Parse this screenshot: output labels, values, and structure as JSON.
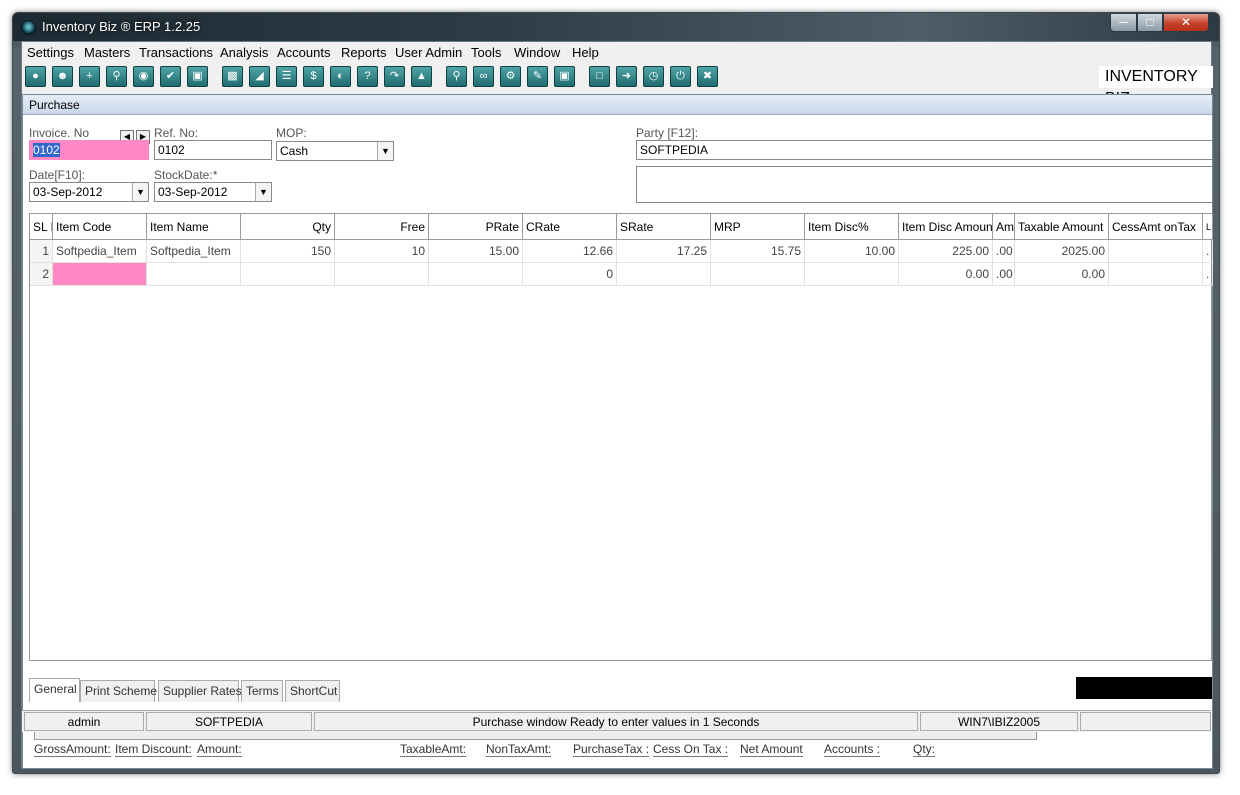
{
  "window": {
    "title": "Inventory Biz ®  ERP 1.2.25",
    "brand": "INVENTORY BIZ"
  },
  "menu": [
    "Settings",
    "Masters",
    "Transactions",
    "Analysis",
    "Accounts",
    "Reports",
    "User Admin",
    "Tools",
    "Window",
    "Help"
  ],
  "toolbar_icons": [
    "new-icon",
    "user-icon",
    "add-icon",
    "search-icon",
    "disk-icon",
    "check-icon",
    "stack-icon",
    "cart-icon",
    "car-icon",
    "list-icon",
    "dollar-icon",
    "globe-icon",
    "help-icon",
    "redo-icon",
    "up-icon",
    "zoom-icon",
    "binoculars-icon",
    "gear-icon",
    "pen-icon",
    "layers-icon",
    "folder-icon",
    "export-icon",
    "clock-icon",
    "power-icon",
    "close-icon"
  ],
  "form": {
    "title": "Purchase",
    "invoice_label": "Invoice. No",
    "invoice_value": "0102",
    "ref_label": "Ref. No:",
    "ref_value": "0102",
    "mop_label": "MOP:",
    "mop_value": "Cash",
    "party_label": "Party [F12]:",
    "party_value": "SOFTPEDIA",
    "date_label": "Date[F10]:",
    "date_value": "03-Sep-2012",
    "stockdate_label": "StockDate:*",
    "stockdate_value": "03-Sep-2012"
  },
  "grid": {
    "headers": [
      "SL N",
      "Item Code",
      "Item Name",
      "Qty",
      "Free",
      "PRate",
      "CRate",
      "SRate",
      "MRP",
      "Item Disc%",
      "Item Disc Amount",
      "Amo",
      "Taxable Amount",
      "CessAmt onTax",
      "L"
    ],
    "rows": [
      [
        "1",
        "Softpedia_Item",
        "Softpedia_Item",
        "150",
        "10",
        "15.00",
        "12.66",
        "17.25",
        "15.75",
        "10.00",
        "225.00",
        ".00",
        "2025.00",
        "",
        "."
      ],
      [
        "2",
        "",
        "",
        "",
        "",
        "",
        "0",
        "",
        "",
        "",
        "0.00",
        ".00",
        "0.00",
        "",
        "."
      ]
    ]
  },
  "tabs": [
    "General",
    "Print Scheme",
    "Supplier Rates",
    "Terms",
    "ShortCut"
  ],
  "totals": [
    "GrossAmount:",
    "Item Discount:",
    "Amount:",
    "TaxableAmt:",
    "NonTaxAmt:",
    "PurchaseTax :",
    "Cess On Tax :",
    "Net Amount",
    "Accounts :",
    "Qty:"
  ],
  "status": {
    "user": "admin",
    "company": "SOFTPEDIA",
    "message": "Purchase window Ready to enter values in 1 Seconds",
    "machine": "WIN7\\IBIZ2005"
  }
}
